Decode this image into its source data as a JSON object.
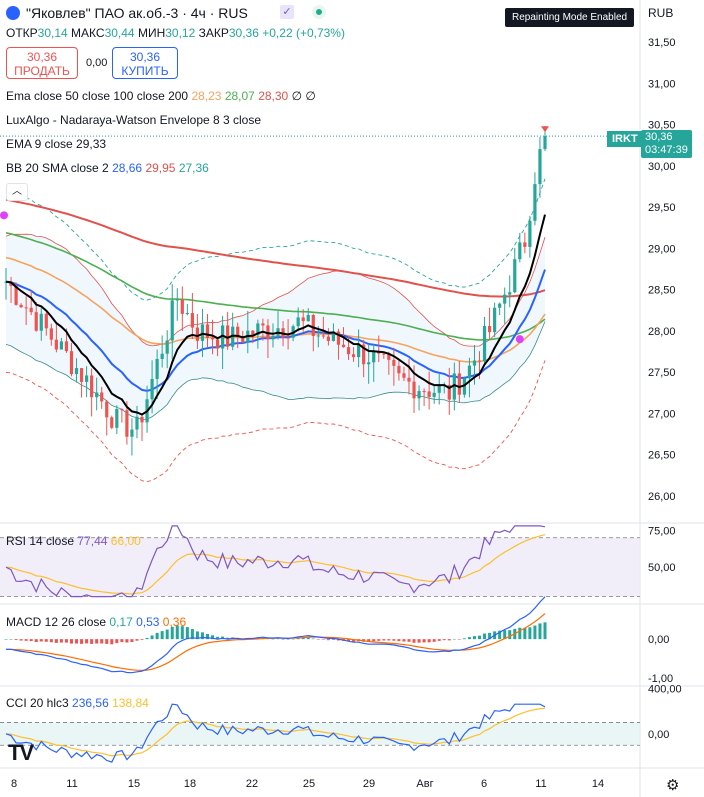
{
  "header": {
    "symbol_title": "\"Яковлев\" ПАО ак.об.-3 · 4ч · RUS",
    "ohlc": [
      {
        "label": "ОТКР",
        "value": "30,14"
      },
      {
        "label": "МАКС",
        "value": "30,44"
      },
      {
        "label": "МИН",
        "value": "30,12"
      },
      {
        "label": "ЗАКР",
        "value": "30,36"
      }
    ],
    "change": "+0,22 (+0,73%)",
    "currency": "RUB",
    "repaint_badge": "Repainting Mode Enabled"
  },
  "trade": {
    "sell_price": "30,36",
    "sell_label": "ПРОДАТЬ",
    "spread": "0,00",
    "buy_price": "30,36",
    "buy_label": "КУПИТЬ"
  },
  "indicators": {
    "ema_multi": {
      "label": "Ema close 50 close 100 close 200",
      "v1": "28,23",
      "v2": "28,07",
      "v3": "28,30",
      "extra": "∅ ∅"
    },
    "luxalgo": {
      "label": "LuxAlgo - Nadaraya-Watson Envelope 8 3 close"
    },
    "ema9": {
      "label": "EMA 9 close",
      "value": "29,33"
    },
    "bb": {
      "label": "BB 20 SMA close 2",
      "v1": "28,66",
      "v2": "29,95",
      "v3": "27,36"
    },
    "rsi": {
      "label": "RSI 14 close",
      "v1": "77,44",
      "v2": "66,00"
    },
    "macd": {
      "label": "MACD 12 26 close",
      "v1": "0,17",
      "v2": "0,53",
      "v3": "0,36"
    },
    "cci": {
      "label": "CCI 20 hlc3",
      "v1": "236,56",
      "v2": "138,84"
    }
  },
  "price_tag": {
    "ticker": "IRKT",
    "price": "30,36",
    "countdown": "03:47:39"
  },
  "colors": {
    "up": "#26a69a",
    "down": "#ef5350",
    "ema50": "#f7a35c",
    "ema100": "#4caf50",
    "ema200": "#e0524b",
    "ema9": "#000000",
    "bb_basis": "#2962ff",
    "bb_band": "#3a8c8c",
    "rsi": "#7e57c2",
    "macd": "#2962ff",
    "signal": "#ff6d00",
    "cci": "#2962ff",
    "cci_ma": "#fbc02d"
  },
  "chart_data": [
    {
      "type": "candlestick",
      "ylabels": [
        "31,50",
        "31,00",
        "30,50",
        "30,00",
        "29,50",
        "29,00",
        "28,50",
        "28,00",
        "27,50",
        "27,00",
        "26,50",
        "26,00"
      ],
      "ylim": [
        25.8,
        31.7
      ],
      "xlabels": [
        "8",
        "11",
        "15",
        "18",
        "22",
        "25",
        "29",
        "Авг",
        "6",
        "11",
        "14"
      ],
      "last": {
        "open": 30.14,
        "high": 30.44,
        "low": 30.12,
        "close": 30.36
      }
    },
    {
      "type": "line",
      "title": "RSI 14 close",
      "ylabels": [
        "75,00",
        "50,00"
      ],
      "ylim": [
        25,
        80
      ]
    },
    {
      "type": "bar",
      "title": "MACD 12 26 close",
      "ylabels": [
        "0,00",
        "-1,00"
      ],
      "ylim": [
        -1.2,
        0.9
      ]
    },
    {
      "type": "line",
      "title": "CCI 20 hlc3",
      "ylabels": [
        "400,00",
        "0,00"
      ],
      "ylim": [
        -300,
        420
      ]
    }
  ]
}
